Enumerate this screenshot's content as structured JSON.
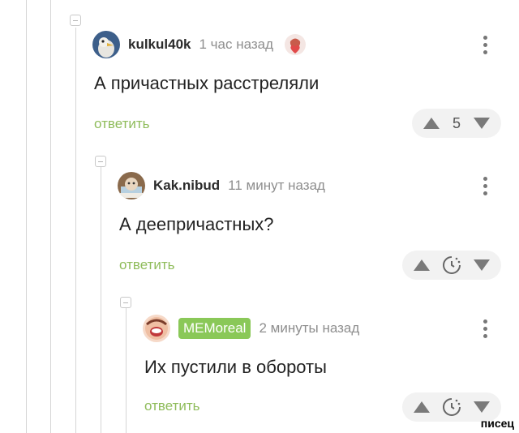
{
  "comments": [
    {
      "username": "kulkul40k",
      "time": "1 час назад",
      "text": "А причастных расстреляли",
      "reply_label": "ответить",
      "score": "5"
    },
    {
      "username": "Kak.nibud",
      "time": "11 минут назад",
      "text": "А деепричастных?",
      "reply_label": "ответить"
    },
    {
      "username": "MEMoreal",
      "time": "2 минуты назад",
      "text": "Их пустили в обороты",
      "reply_label": "ответить"
    }
  ],
  "watermark": "писец",
  "colors": {
    "reply_green": "#8fbc5b",
    "badge_green": "#8ac858",
    "rating_bg": "#f2f2f2"
  },
  "icons": [
    "collapse-icon",
    "avatar",
    "more-icon",
    "upvote-icon",
    "downvote-icon",
    "timer-icon"
  ]
}
